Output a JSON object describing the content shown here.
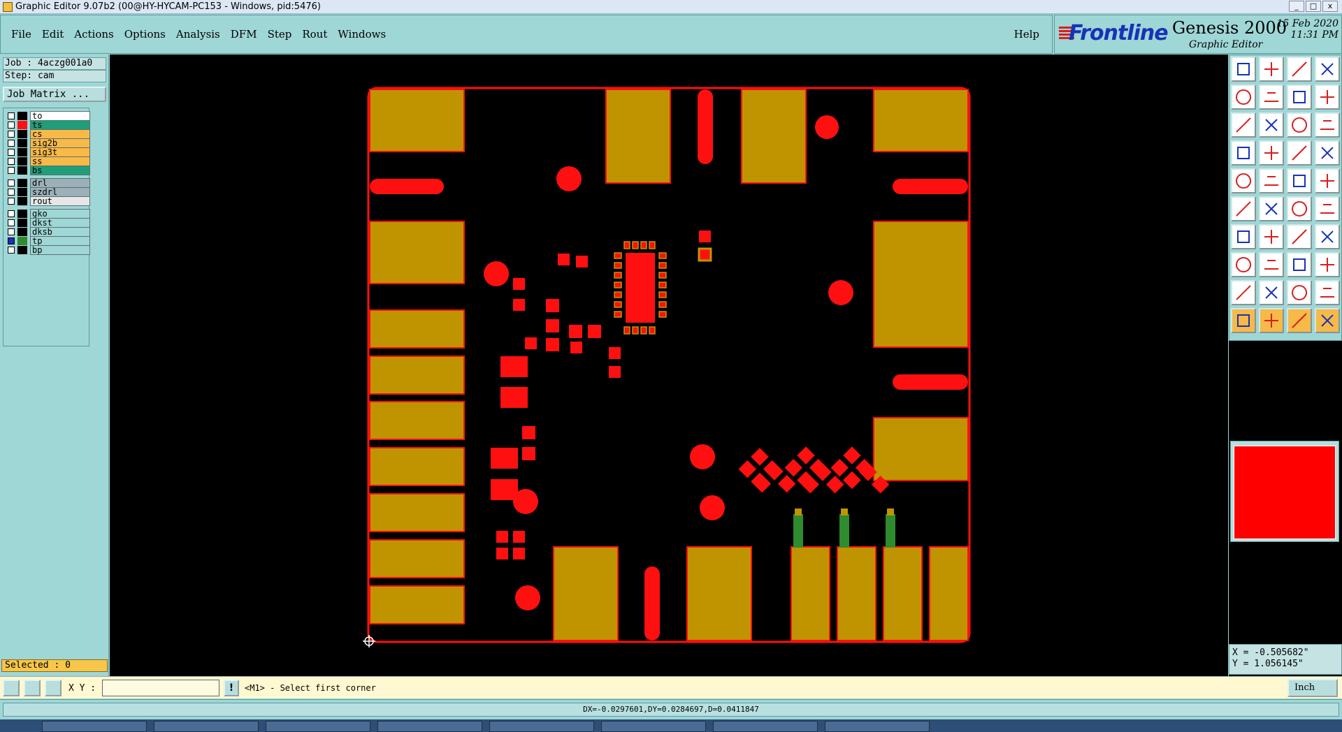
{
  "window": {
    "title": "Graphic Editor 9.07b2 (00@HY-HYCAM-PC153 - Windows, pid:5476)",
    "controls": [
      "_",
      "□",
      "x"
    ]
  },
  "menu": {
    "items": [
      "File",
      "Edit",
      "Actions",
      "Options",
      "Analysis",
      "DFM",
      "Step",
      "Rout",
      "Windows"
    ],
    "help": "Help"
  },
  "brand": {
    "logo": "Frontline",
    "product": "Genesis 2000",
    "subtitle": "Graphic Editor",
    "date": "15 Feb 2020",
    "time": "11:31 PM"
  },
  "job": {
    "job_label": "Job : 4aczg001a0",
    "step_label": "Step: cam",
    "matrix_button": "Job Matrix ..."
  },
  "layers": [
    {
      "name": "to",
      "color": "#ffffff",
      "swatch": "#000000",
      "active": false
    },
    {
      "name": "ts",
      "color": "#1f9e7a",
      "swatch": "#ff1010",
      "active": false
    },
    {
      "name": "cs",
      "color": "#f7b948",
      "swatch": "#000000",
      "active": false
    },
    {
      "name": "sig2b",
      "color": "#f7b948",
      "swatch": "#000000",
      "active": false
    },
    {
      "name": "sig3t",
      "color": "#f7b948",
      "swatch": "#000000",
      "active": false
    },
    {
      "name": "ss",
      "color": "#f7b948",
      "swatch": "#000000",
      "active": false
    },
    {
      "name": "bs",
      "color": "#1f9e7a",
      "swatch": "#000000",
      "active": false
    },
    {
      "name": "drl",
      "color": "#9bb0b8",
      "swatch": "#000000",
      "active": false
    },
    {
      "name": "szdrl",
      "color": "#9bb0b8",
      "swatch": "#000000",
      "active": false
    },
    {
      "name": "rout",
      "color": "#e6e6e6",
      "swatch": "#000000",
      "active": false
    },
    {
      "name": "gko",
      "color": "#9fd6d6",
      "swatch": "#000000",
      "active": false
    },
    {
      "name": "dkst",
      "color": "#9fd6d6",
      "swatch": "#000000",
      "active": false
    },
    {
      "name": "dksb",
      "color": "#9fd6d6",
      "swatch": "#000000",
      "active": false
    },
    {
      "name": "tp",
      "color": "#9fd6d6",
      "swatch": "#2e8b2e",
      "active": true
    },
    {
      "name": "bp",
      "color": "#9fd6d6",
      "swatch": "#000000",
      "active": false
    }
  ],
  "selected": "Selected : 0",
  "coords": {
    "x": "X = -0.505682\"",
    "y": "Y = 1.056145\""
  },
  "command": {
    "xy_label": "X Y :",
    "xy_value": "",
    "bang": "!",
    "prompt": "<M1> - Select first corner",
    "unit": "Inch"
  },
  "status": "DX=-0.0297601,DY=0.0284697,D=0.0411847",
  "colors": {
    "board_outline": "#ff1010",
    "pads_gold": "#c09400",
    "traces_green": "#2e8b2e",
    "background": "#000000",
    "panel": "#9fd6d6"
  }
}
